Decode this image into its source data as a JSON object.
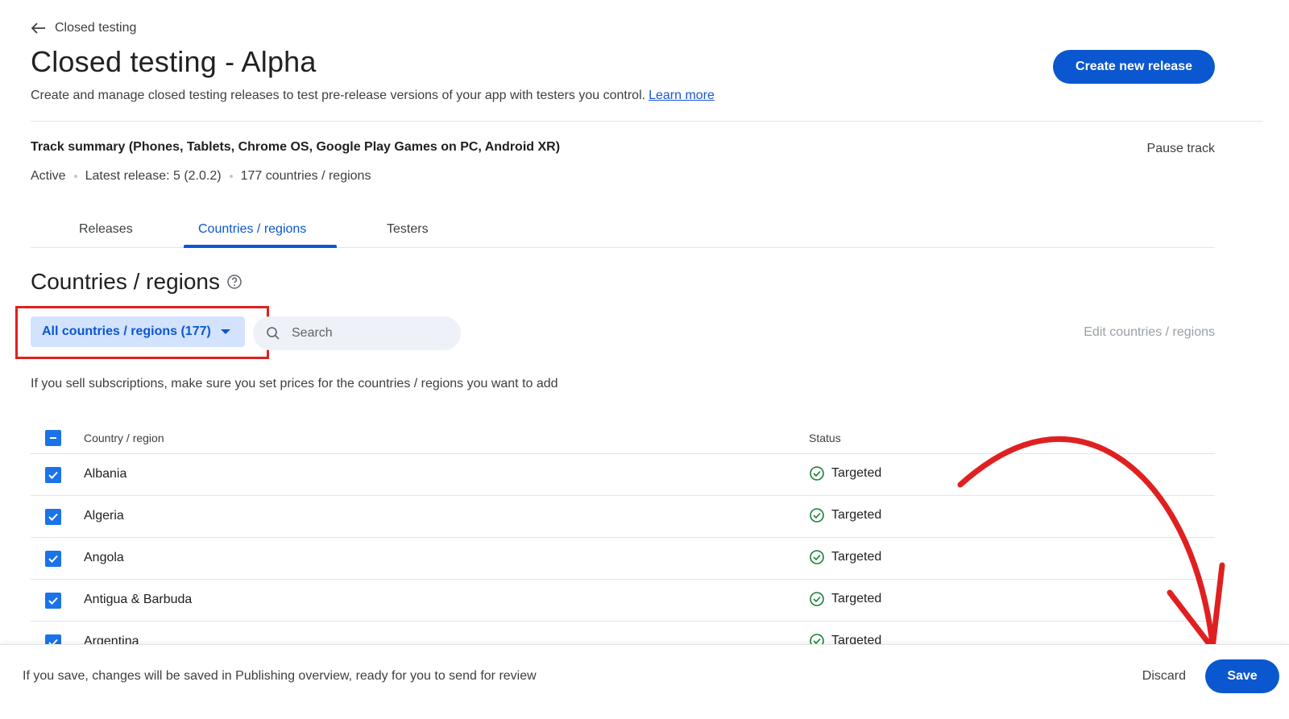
{
  "breadcrumb": {
    "back_label": "Closed testing"
  },
  "header": {
    "title": "Closed testing - Alpha",
    "subtitle": "Create and manage closed testing releases to test pre-release versions of your app with testers you control.",
    "learn_more": "Learn more",
    "create_release_label": "Create new release"
  },
  "track": {
    "summary_title": "Track summary (Phones, Tablets, Chrome OS, Google Play Games on PC, Android XR)",
    "pause_label": "Pause track",
    "status": "Active",
    "latest_release": "Latest release: 5 (2.0.2)",
    "countries_count": "177 countries / regions"
  },
  "tabs": [
    {
      "label": "Releases",
      "active": false
    },
    {
      "label": "Countries / regions",
      "active": true
    },
    {
      "label": "Testers",
      "active": false
    }
  ],
  "section": {
    "title": "Countries / regions",
    "filter_label": "All countries / regions (177)",
    "search_placeholder": "Search",
    "edit_label": "Edit countries / regions",
    "info": "If you sell subscriptions, make sure you set prices for the countries / regions you want to add"
  },
  "table": {
    "headers": {
      "country": "Country / region",
      "status": "Status"
    },
    "rows": [
      {
        "country": "Albania",
        "status": "Targeted"
      },
      {
        "country": "Algeria",
        "status": "Targeted"
      },
      {
        "country": "Angola",
        "status": "Targeted"
      },
      {
        "country": "Antigua & Barbuda",
        "status": "Targeted"
      },
      {
        "country": "Argentina",
        "status": "Targeted"
      }
    ]
  },
  "footer": {
    "message": "If you save, changes will be saved in Publishing overview, ready for you to send for review",
    "discard_label": "Discard",
    "save_label": "Save"
  },
  "colors": {
    "primary": "#0b57d0",
    "chip_bg": "#d3e3fd",
    "checkbox": "#1a73e8",
    "success": "#188038",
    "annotation": "#e02020"
  },
  "icons": {
    "back": "arrow-left-icon",
    "help": "help-circle-icon",
    "search": "search-icon",
    "dropdown": "caret-down-icon",
    "status": "check-circle-icon"
  }
}
